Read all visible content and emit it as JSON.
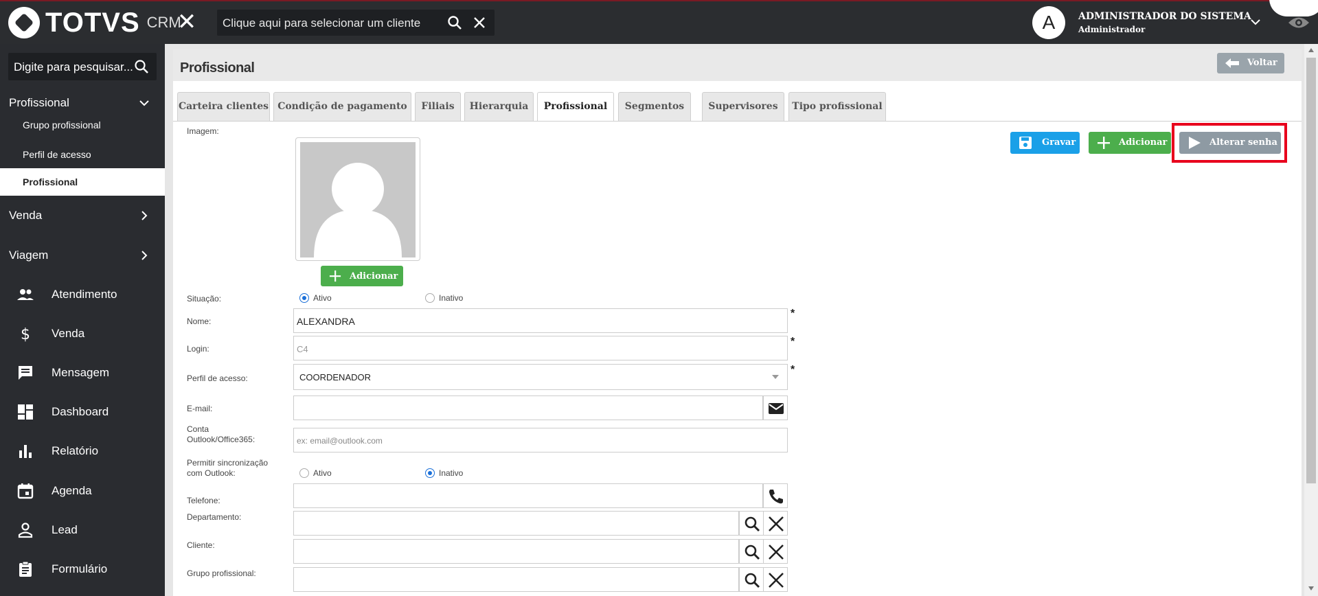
{
  "topbar": {
    "logo_text": "TOTVS",
    "logo_suffix": "CRM",
    "client_placeholder": "Clique aqui para selecionar um cliente",
    "user_initial": "A",
    "user_name": "ADMINISTRADOR DO SISTEMA",
    "user_role": "Administrador"
  },
  "sidebar": {
    "search_placeholder": "Digite para pesquisar...",
    "group_open": "Profissional",
    "sub_items": [
      {
        "label": "Grupo profissional"
      },
      {
        "label": "Perfil de acesso"
      },
      {
        "label": "Profissional"
      }
    ],
    "groups": [
      {
        "label": "Venda"
      },
      {
        "label": "Viagem"
      }
    ],
    "items": [
      {
        "label": "Atendimento",
        "icon": "people-icon"
      },
      {
        "label": "Venda",
        "icon": "dollar-icon"
      },
      {
        "label": "Mensagem",
        "icon": "message-icon"
      },
      {
        "label": "Dashboard",
        "icon": "dashboard-icon"
      },
      {
        "label": "Relatório",
        "icon": "bar-chart-icon"
      },
      {
        "label": "Agenda",
        "icon": "calendar-icon"
      },
      {
        "label": "Lead",
        "icon": "person-icon"
      },
      {
        "label": "Formulário",
        "icon": "clipboard-icon"
      }
    ]
  },
  "page": {
    "title": "Profissional",
    "back_label": "Voltar"
  },
  "tabs": [
    {
      "label": "Carteira clientes"
    },
    {
      "label": "Condição de pagamento"
    },
    {
      "label": "Filiais"
    },
    {
      "label": "Hierarquia"
    },
    {
      "label": "Profissional"
    },
    {
      "label": "Segmentos"
    },
    {
      "label": "Supervisores"
    },
    {
      "label": "Tipo profissional"
    }
  ],
  "active_tab": "Profissional",
  "actions": {
    "save": "Gravar",
    "add": "Adicionar",
    "change_password": "Alterar senha"
  },
  "form": {
    "image_label": "Imagem:",
    "image_add": "Adicionar",
    "status_label": "Situação:",
    "status_active": "Ativo",
    "status_inactive": "Inativo",
    "status_value": "Ativo",
    "name_label": "Nome:",
    "name_value": "ALEXANDRA",
    "login_label": "Login:",
    "login_value": "C4",
    "profile_label": "Perfil de acesso:",
    "profile_value": "COORDENADOR",
    "email_label": "E-mail:",
    "email_value": "",
    "outlook_label_1": "Conta",
    "outlook_label_2": "Outlook/Office365:",
    "outlook_placeholder": "ex: email@outlook.com",
    "sync_label_1": "Permitir sincronização",
    "sync_label_2": "com Outlook:",
    "sync_active": "Ativo",
    "sync_inactive": "Inativo",
    "sync_value": "Inativo",
    "phone_label": "Telefone:",
    "department_label": "Departamento:",
    "client_label": "Cliente:",
    "group_label": "Grupo profissional:",
    "required_mark": "*"
  },
  "colors": {
    "topbar": "#2b2d30",
    "save": "#1aa0e8",
    "add": "#4cae4c",
    "change_password": "#8e9aa3",
    "highlight": "#e8001c"
  }
}
